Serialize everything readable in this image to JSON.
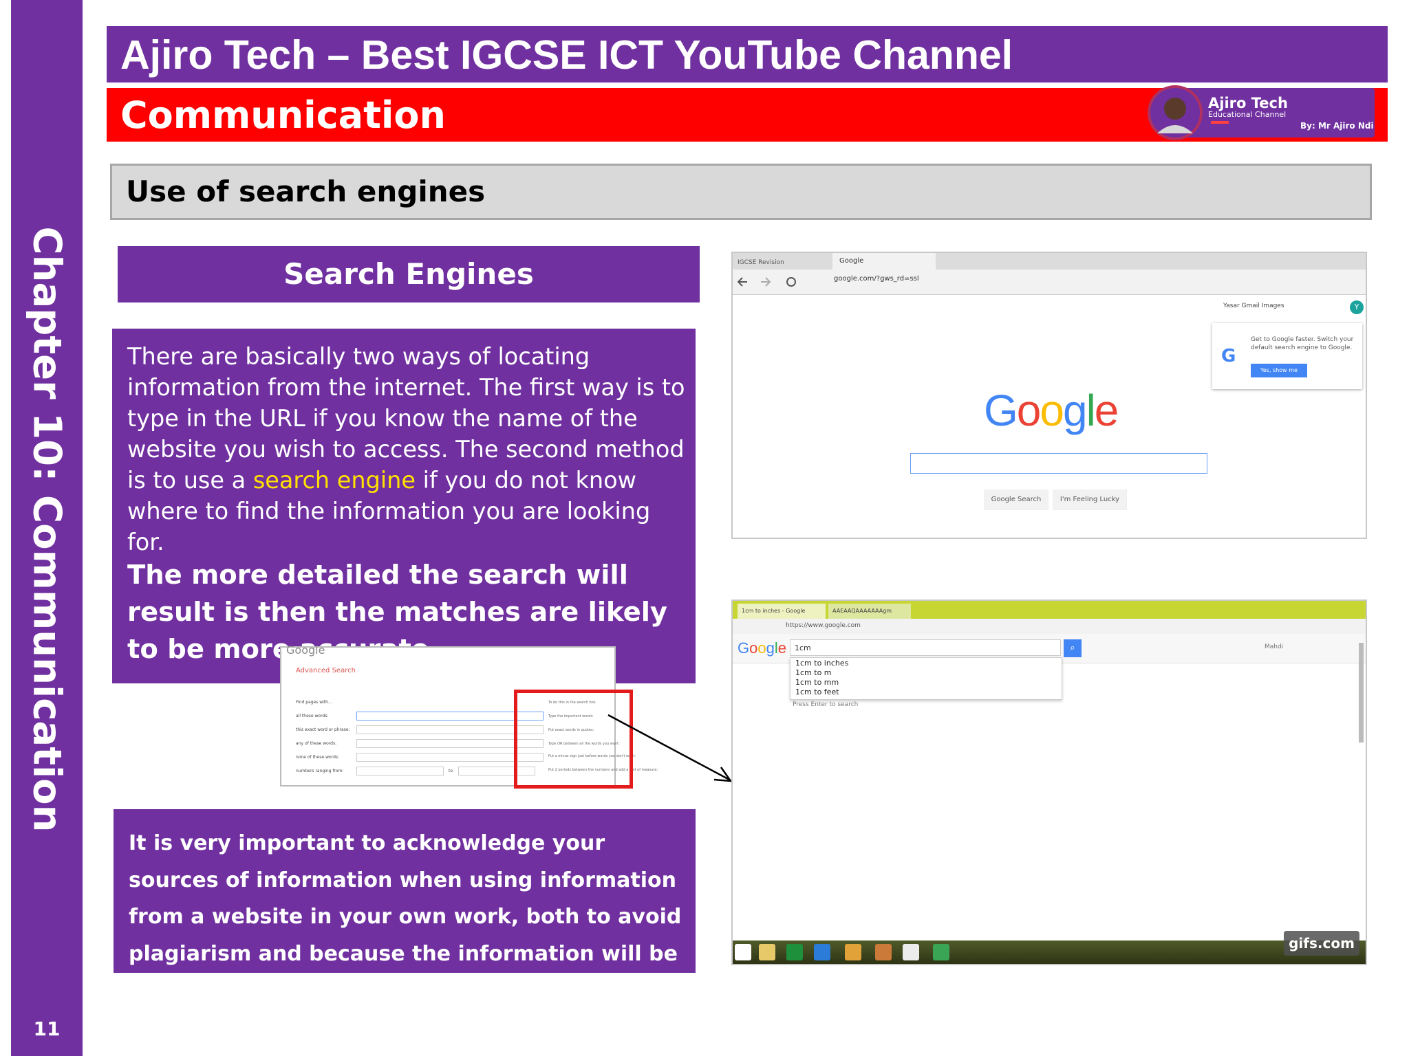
{
  "title": "Ajiro Tech – Best IGCSE ICT YouTube Channel",
  "topic": "Communication",
  "logo": {
    "name": "Ajiro Tech",
    "subtitle": "Educational Channel",
    "author": "By: Mr Ajiro Ndi"
  },
  "section_heading": "Use of search engines",
  "sidebar": {
    "chapter": "Chapter 10: Communication",
    "page_number": "11"
  },
  "search_engines_header": "Search Engines",
  "paragraph1": {
    "before": "There are basically two ways of locating information from the internet. The first way is to type in the URL if you know the name of the website you wish to access. The second method is to use a ",
    "highlight": "search engine",
    "after": " if you do not know where to find the information you are looking for."
  },
  "paragraph2": "The more detailed the search will result is then the matches are likely to be more accurate.",
  "paragraph3": "It is very important to acknowledge your sources of information when using information from a website in your own work, both to avoid plagiarism and because the information will be subject to copyright.",
  "advanced_search": {
    "logo": "Google",
    "title": "Advanced Search",
    "section": "Find pages with...",
    "fields": [
      "all these words:",
      "this exact word or phrase:",
      "any of these words:",
      "none of these words:",
      "numbers ranging from:"
    ],
    "to_label": "to",
    "notes_title": "To do this in the search box",
    "notes": [
      "Type the important words:",
      "Put exact words in quotes:",
      "Type OR between all the words you want:",
      "Put a minus sign just before words you don't want:",
      "Put 2 periods between the numbers and add a unit of measure:"
    ]
  },
  "screenshot1": {
    "tab1": "IGCSE Revision",
    "tab2": "Google",
    "url": "google.com/?gws_rd=ssl",
    "top_links": "Yasar   Gmail   Images",
    "avatar": "Y",
    "popup_text": "Get to Google faster. Switch your default search engine to Google.",
    "popup_button": "Yes, show me",
    "google_search_button": "Google Search",
    "lucky_button": "I'm Feeling Lucky"
  },
  "screenshot2": {
    "tab1": "1cm to inches - Google",
    "tab2": "AAEAAQAAAAAAAgm",
    "url": "https://www.google.com",
    "query": "1cm",
    "suggestions": [
      "1cm to inches",
      "1cm to m",
      "1cm to mm",
      "1cm to feet"
    ],
    "hint": "Press Enter to search",
    "user": "Mahdi",
    "watermark": "gifs.com"
  }
}
